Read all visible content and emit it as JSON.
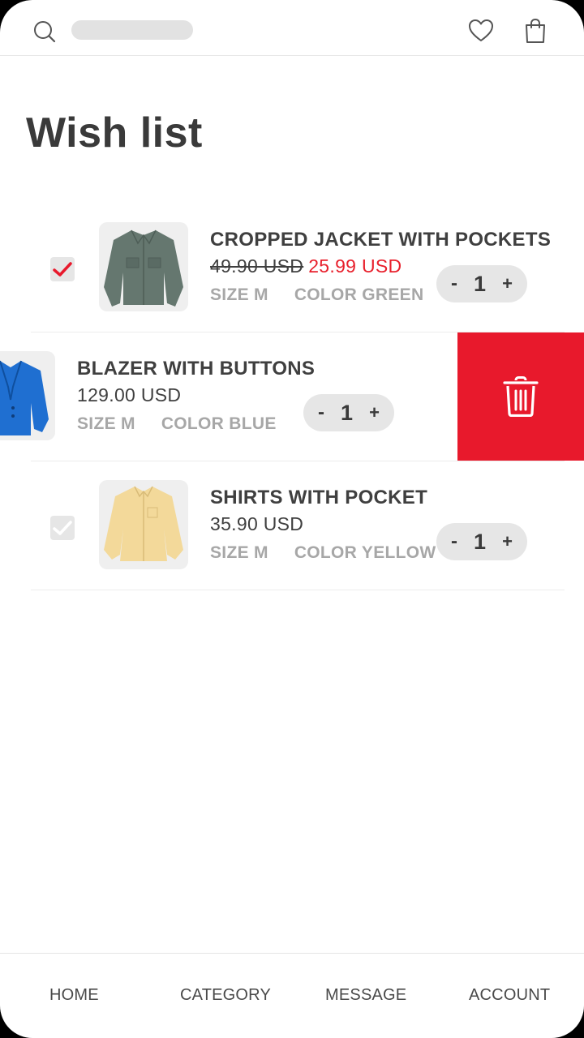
{
  "header": {
    "search_icon": "search-icon",
    "wishlist_icon": "heart-icon",
    "bag_icon": "shopping-bag-icon"
  },
  "page_title": "Wish list",
  "items": [
    {
      "name": "CROPPED JACKET WITH POCKETS",
      "old_price": "49.90 USD",
      "price": "25.99 USD",
      "size": "SIZE M",
      "color": "COLOR GREEN",
      "quantity": "1",
      "checked": true,
      "image": "green jacket"
    },
    {
      "name": "BLAZER WITH BUTTONS",
      "price": "129.00 USD",
      "size": "SIZE M",
      "color": "COLOR BLUE",
      "quantity": "1",
      "image": "blue blazer",
      "swiped": true
    },
    {
      "name": "SHIRTS WITH POCKET",
      "price": "35.90 USD",
      "size": "SIZE M",
      "color": "COLOR YELLOW",
      "quantity": "1",
      "checked": false,
      "image": "yellow shirt"
    }
  ],
  "stepper": {
    "minus": "-",
    "plus": "+"
  },
  "delete_icon": "trash-icon",
  "nav": {
    "home": "HOME",
    "category": "CATEGORY",
    "message": "MESSAGE",
    "account": "ACCOUNT"
  },
  "colors": {
    "accent_red": "#e8192c",
    "sale_red": "#e8202c",
    "text_dark": "#3f3f3f",
    "text_muted": "#a7a7a7"
  }
}
